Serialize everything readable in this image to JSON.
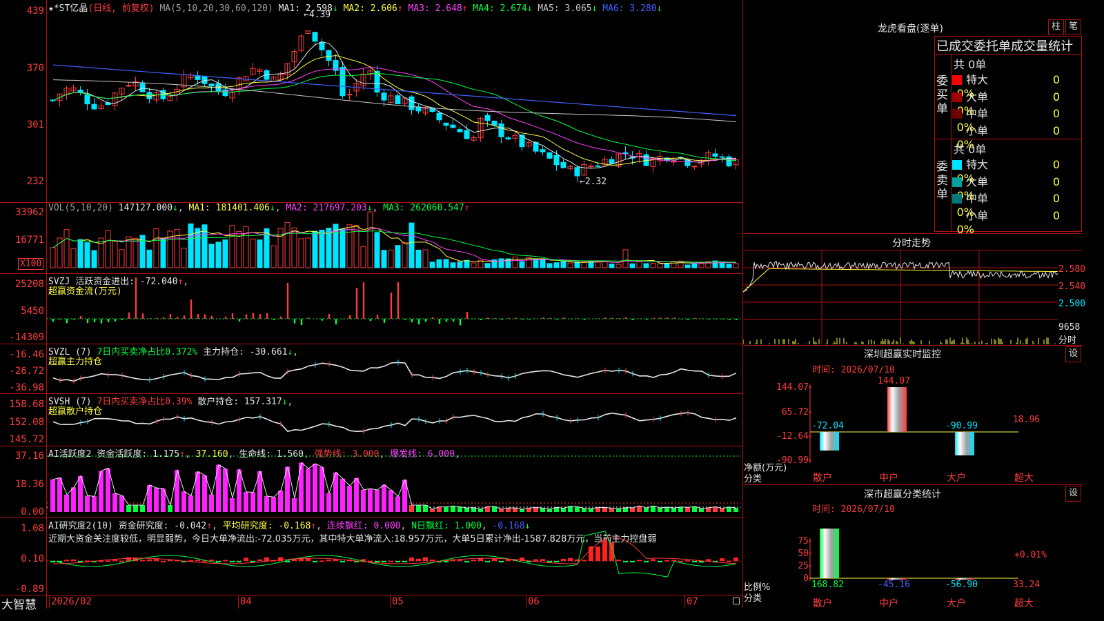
{
  "stock": {
    "name": "ST亿晶",
    "mode": "(日线, 前复权)",
    "ma_label": "MA(5,10,20,30,60,120)",
    "ma_values": [
      {
        "label": "MA1:",
        "value": "2.598",
        "arrow": "↓",
        "color": "#e6e6e6"
      },
      {
        "label": "MA2:",
        "value": "2.606",
        "arrow": "↑",
        "color": "#ffff40"
      },
      {
        "label": "MA3:",
        "value": "2.648",
        "arrow": "↑",
        "color": "#ff40ff"
      },
      {
        "label": "MA4:",
        "value": "2.674",
        "arrow": "↓",
        "color": "#00ff40"
      },
      {
        "label": "MA5:",
        "value": "3.065",
        "arrow": "↓",
        "color": "#c8c8c8"
      },
      {
        "label": "MA6:",
        "value": "3.280",
        "arrow": "↓",
        "color": "#4060ff"
      }
    ],
    "price_axis": [
      "439",
      "370",
      "301",
      "232"
    ],
    "high_label": "4.39",
    "low_label": "2.32"
  },
  "vol": {
    "label": "VOL(5,10,20)",
    "value": "147127.000",
    "ma1": "MA1: 181401.406",
    "ma2": "MA2: 217697.203",
    "ma3": "MA3: 262060.547",
    "axis": [
      "33962",
      "16771"
    ],
    "unit": "X100"
  },
  "svzj": {
    "title": "SVZJ  活跃资金进出: -72.040",
    "subtitle": "超赢资金流(万元)",
    "axis": [
      "25208",
      "5450",
      "-14309"
    ]
  },
  "svzl": {
    "title": "SVZL (7)",
    "stat": "7日内买卖净占比0.372%",
    "hold": "主力持仓: -30.661",
    "subtitle": "超赢主力持仓",
    "axis": [
      "-16.46",
      "-26.72",
      "-36.98"
    ]
  },
  "svsh": {
    "title": "SVSH (7)",
    "stat": "7日内买卖净占比0.39%",
    "hold": "散户持仓: 157.317",
    "subtitle": "超赢散户持仓",
    "axis": [
      "158.68",
      "152.08",
      "145.72"
    ]
  },
  "ai_active": {
    "title": "AI活跃度2",
    "a": "资金活跃度: 1.175",
    "b": "37.160",
    "c": "生命线: 1.560",
    "d": "强势线: 3.000",
    "e": "爆发线: 6.000",
    "axis": [
      "37.16",
      "18.36",
      "0.00"
    ]
  },
  "ai_research": {
    "title": "AI研究度2(10)",
    "a": "资金研究度: -0.042",
    "b": "平均研究度: -0.168",
    "c": "连续飘红: 0.000",
    "d": "N日飘红: 1.000",
    "e": "-0.168",
    "comment": "近期大资金关注度较低，明显弱势，今日大单净流出:-72.035万元，其中特大单净流入:18.957万元，大单5日累计净出-1587.828万元，当前主力控盘弱",
    "axis": [
      "1.08",
      "0.10",
      "-0.89"
    ]
  },
  "time_axis": [
    "2026/02",
    "04",
    "05",
    "06",
    "07"
  ],
  "brand": "大智慧",
  "right": {
    "lhb_title": "龙虎看盘(逐单)",
    "btn_col": "柱",
    "btn_pen": "笔",
    "stat_title": "已成交委托单成交量统计",
    "buy_label": "委买单",
    "sell_label": "委卖单",
    "buy_total": "共 0单",
    "sell_total": "共 0单",
    "buy_rows": [
      {
        "name": "特大",
        "count": "0",
        "pct": "0%",
        "color": "#ff0000"
      },
      {
        "name": "大单",
        "count": "0",
        "pct": "0%",
        "color": "#a00000"
      },
      {
        "name": "中单",
        "count": "0",
        "pct": "0%",
        "color": "#700000"
      },
      {
        "name": "小单",
        "count": "0",
        "pct": "0%",
        "color": ""
      }
    ],
    "sell_rows": [
      {
        "name": "特大",
        "count": "0",
        "pct": "0%",
        "color": "#00e5ff"
      },
      {
        "name": "大单",
        "count": "0",
        "pct": "0%",
        "color": "#00a0a0"
      },
      {
        "name": "中单",
        "count": "0",
        "pct": "0%",
        "color": "#007878"
      },
      {
        "name": "小单",
        "count": "0",
        "pct": "0%",
        "color": ""
      }
    ],
    "intraday_title": "分时走势",
    "intraday_axis": [
      "2.580",
      "2.540",
      "2.500"
    ],
    "intraday_vol": "9658",
    "intraday_unit": "分时",
    "monitor_title": "深圳超赢实时监控",
    "set1": "设",
    "monitor_date": "时间: 2026/07/10",
    "monitor_axis": [
      "144.07",
      "65.72",
      "-12.64",
      "-90.99"
    ],
    "monitor_values": [
      {
        "label": "散户",
        "value": "-72.04"
      },
      {
        "label": "中户",
        "value": "144.07"
      },
      {
        "label": "大户",
        "value": "-90.99"
      },
      {
        "label": "超大",
        "value": "18.96"
      }
    ],
    "monitor_yname1": "净额(万元)",
    "monitor_yname2": "分类",
    "class_title": "深市超赢分类统计",
    "set2": "设",
    "class_date": "时间: 2026/07/10",
    "class_axis": [
      "75",
      "50",
      "25",
      "0"
    ],
    "class_values": [
      {
        "label": "散户",
        "value": "168.82"
      },
      {
        "label": "中户",
        "value": "-45.16"
      },
      {
        "label": "大户",
        "value": "-56.90"
      },
      {
        "label": "超大",
        "value": "33.24"
      }
    ],
    "class_pct": "+0.01%",
    "class_yname1": "比例%",
    "class_yname2": "分类"
  }
}
